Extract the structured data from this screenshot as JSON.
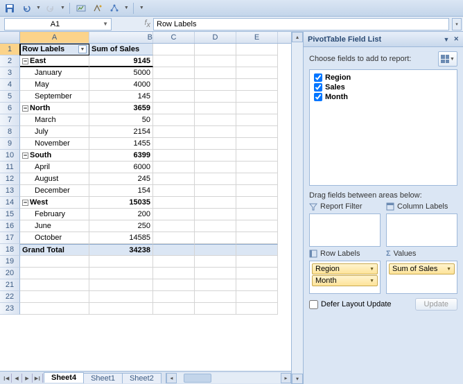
{
  "qat": {
    "save": "save",
    "undo": "undo",
    "redo": "redo"
  },
  "namebox": {
    "cell": "A1"
  },
  "formula_bar": {
    "value": "Row Labels"
  },
  "columns": [
    "A",
    "B",
    "C",
    "D",
    "E"
  ],
  "widths": {
    "A": 100,
    "B": 92,
    "C": 60,
    "D": 60,
    "E": 60
  },
  "pivot": {
    "header_row_labels": "Row Labels",
    "header_values": "Sum of Sales",
    "groups": [
      {
        "region": "East",
        "total": "9145",
        "items": [
          {
            "label": "January",
            "value": "5000"
          },
          {
            "label": "May",
            "value": "4000"
          },
          {
            "label": "September",
            "value": "145"
          }
        ]
      },
      {
        "region": "North",
        "total": "3659",
        "items": [
          {
            "label": "March",
            "value": "50"
          },
          {
            "label": "July",
            "value": "2154"
          },
          {
            "label": "November",
            "value": "1455"
          }
        ]
      },
      {
        "region": "South",
        "total": "6399",
        "items": [
          {
            "label": "April",
            "value": "6000"
          },
          {
            "label": "August",
            "value": "245"
          },
          {
            "label": "December",
            "value": "154"
          }
        ]
      },
      {
        "region": "West",
        "total": "15035",
        "items": [
          {
            "label": "February",
            "value": "200"
          },
          {
            "label": "June",
            "value": "250"
          },
          {
            "label": "October",
            "value": "14585"
          }
        ]
      }
    ],
    "grand_label": "Grand Total",
    "grand_value": "34238"
  },
  "blank_rows": [
    19,
    20,
    21,
    22,
    23
  ],
  "tabs": {
    "active": "Sheet4",
    "others": [
      "Sheet1",
      "Sheet2"
    ]
  },
  "pane": {
    "title": "PivotTable Field List",
    "choose_label": "Choose fields to add to report:",
    "fields": [
      {
        "name": "Region",
        "checked": true
      },
      {
        "name": "Sales",
        "checked": true
      },
      {
        "name": "Month",
        "checked": true
      }
    ],
    "drag_label": "Drag fields between areas below:",
    "area_filter": "Report Filter",
    "area_columns": "Column Labels",
    "area_rows": "Row Labels",
    "area_values": "Values",
    "row_fields": [
      "Region",
      "Month"
    ],
    "value_fields": [
      "Sum of Sales"
    ],
    "defer_label": "Defer Layout Update",
    "update_label": "Update"
  }
}
